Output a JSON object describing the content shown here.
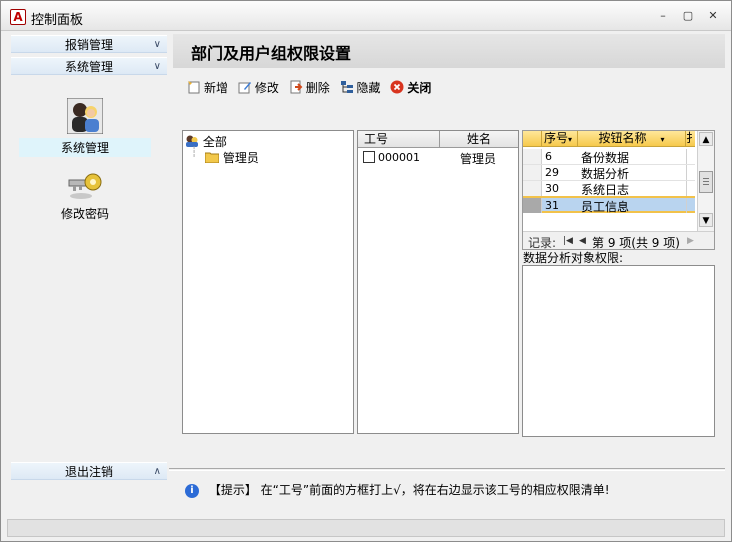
{
  "window": {
    "title": "控制面板"
  },
  "sidebar": {
    "groups": [
      {
        "label": "报销管理"
      },
      {
        "label": "系统管理"
      }
    ],
    "items": [
      {
        "label": "系统管理",
        "icon": "users-icon"
      },
      {
        "label": "修改密码",
        "icon": "key-icon"
      }
    ],
    "bottom": {
      "label": "退出注销"
    }
  },
  "main": {
    "title": "部门及用户组权限设置",
    "toolbar": {
      "add": "新增",
      "edit": "修改",
      "delete": "删除",
      "hide": "隐藏",
      "close": "关闭"
    },
    "tree": {
      "root": "全部",
      "children": [
        "管理员"
      ]
    },
    "users": {
      "columns": [
        "工号",
        "姓名"
      ],
      "rows": [
        {
          "id": "000001",
          "name": "管理员"
        }
      ]
    },
    "buttons_table": {
      "columns": [
        "序号",
        "按钮名称",
        "扌"
      ],
      "rows": [
        {
          "no": "6",
          "name": "备份数据"
        },
        {
          "no": "29",
          "name": "数据分析"
        },
        {
          "no": "30",
          "name": "系统日志"
        },
        {
          "no": "31",
          "name": "员工信息"
        }
      ],
      "nav": {
        "label": "记录:",
        "position": "第 9 项(共 9 项)"
      }
    },
    "analysis_label": "数据分析对象权限:"
  },
  "tip": {
    "text": "【提示】 在“工号”前面的方框打上√，将在右边显示该工号的相应权限清单!"
  }
}
